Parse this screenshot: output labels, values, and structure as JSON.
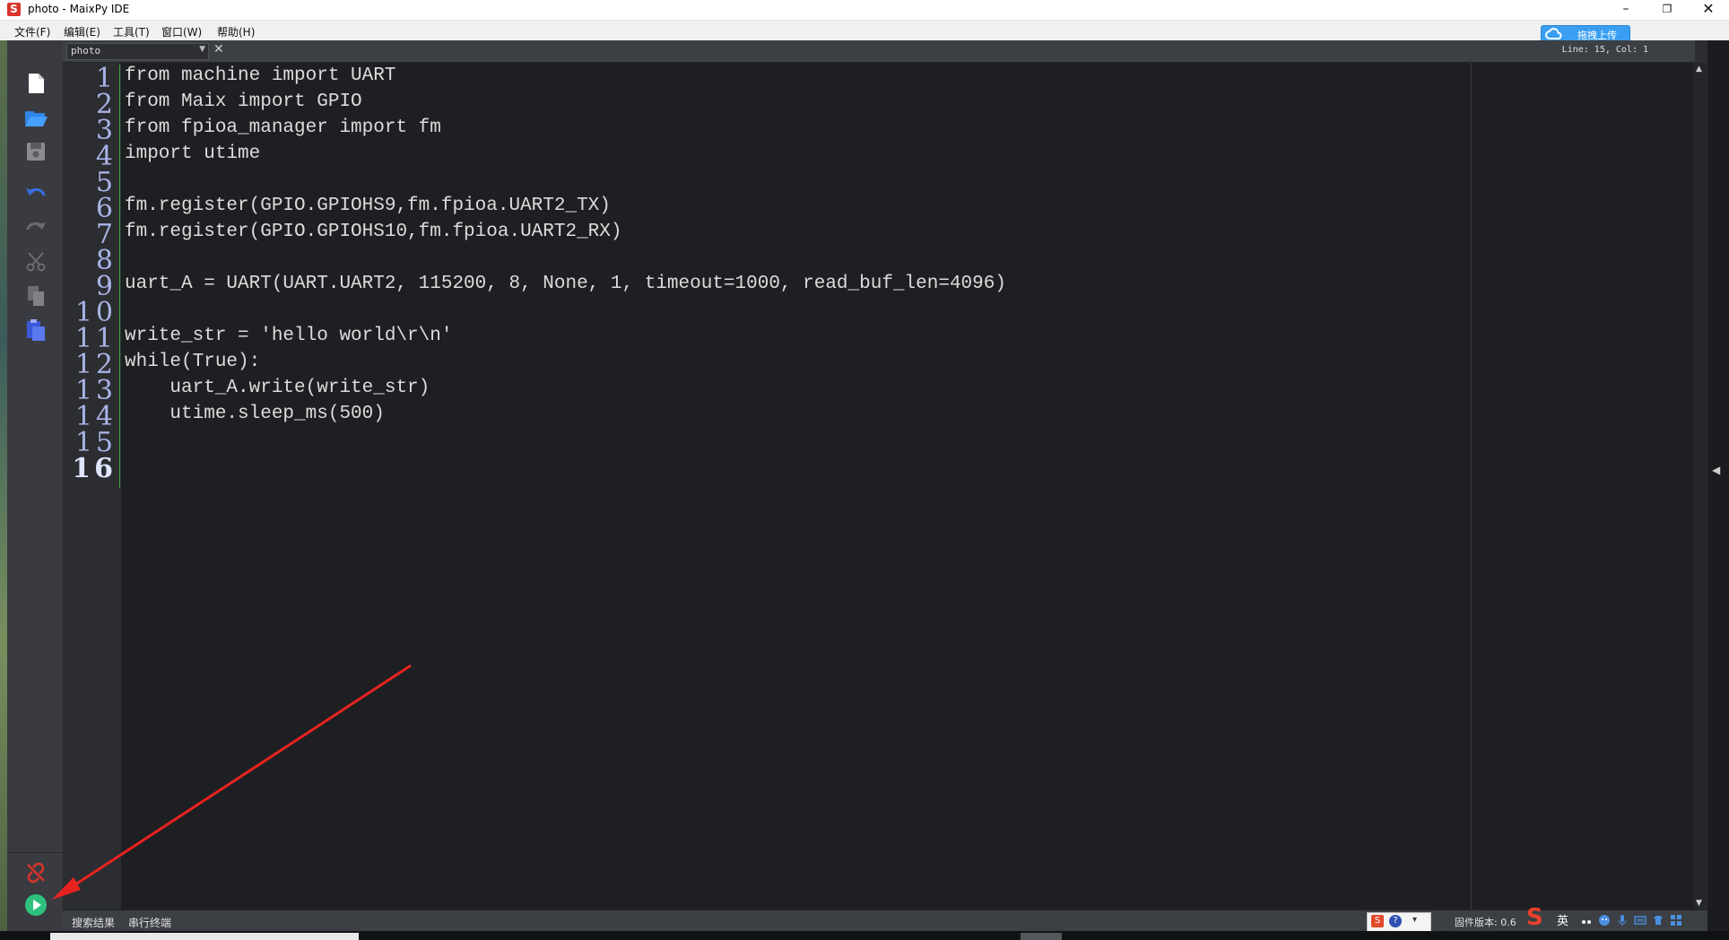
{
  "window": {
    "title": "photo - MaixPy IDE",
    "logo_letter": "S",
    "min": "–",
    "restore": "❐",
    "close": "✕"
  },
  "menu": {
    "file": "文件(F)",
    "edit": "编辑(E)",
    "tools": "工具(T)",
    "window": "窗口(W)",
    "help": "帮助(H)"
  },
  "cloud_upload": {
    "label": "拖拽上传"
  },
  "editor": {
    "file_name": "photo",
    "cursor_position": "Line: 15, Col: 1",
    "current_line": 16,
    "line_numbers": [
      "1",
      "2",
      "3",
      "4",
      "5",
      "6",
      "7",
      "8",
      "9",
      "10",
      "11",
      "12",
      "13",
      "14",
      "15",
      "16"
    ],
    "code_lines": [
      "from machine import UART",
      "from Maix import GPIO",
      "from fpioa_manager import fm",
      "import utime",
      "",
      "fm.register(GPIO.GPIOHS9,fm.fpioa.UART2_TX)",
      "fm.register(GPIO.GPIOHS10,fm.fpioa.UART2_RX)",
      "",
      "uart_A = UART(UART.UART2, 115200, 8, None, 1, timeout=1000, read_buf_len=4096)",
      "",
      "write_str = 'hello world\\r\\n'",
      "while(True):",
      "    uart_A.write(write_str)",
      "    utime.sleep_ms(500)",
      "",
      ""
    ]
  },
  "statusbar": {
    "search_results": "搜索结果",
    "serial_terminal": "串行终端",
    "firmware_label": "固件版本: 0.6"
  },
  "ime": {
    "lang": "英"
  },
  "colors": {
    "accent_green": "#2ec27e",
    "connect_red": "#d9342b",
    "arrow_red": "#e8231f",
    "line_number": "#a9b3e6"
  },
  "icons": {
    "new_file": "file-icon",
    "open": "folder-open-icon",
    "save": "save-icon",
    "undo": "undo-icon",
    "redo": "redo-icon",
    "cut": "scissors-icon",
    "copy": "copy-icon",
    "paste": "paste-icon",
    "connect": "disconnected-link-icon",
    "run": "play-icon"
  }
}
